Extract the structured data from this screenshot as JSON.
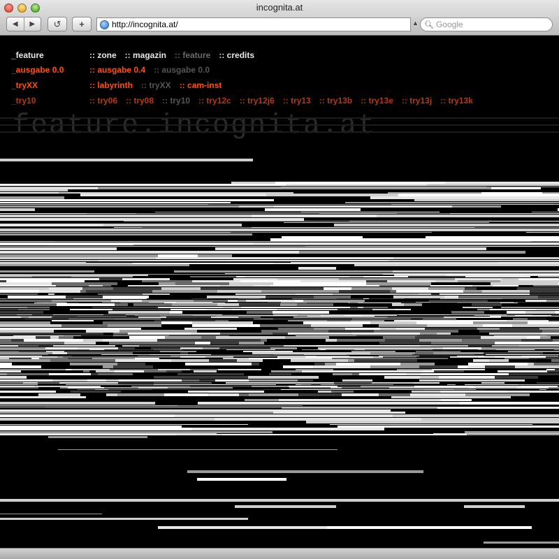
{
  "window": {
    "title": "incognita.at"
  },
  "toolbar": {
    "back_icon": "back-arrow-icon",
    "forward_icon": "forward-arrow-icon",
    "reload_icon": "reload-icon",
    "add_icon": "plus-icon",
    "url": "http://incognita.at/",
    "search_placeholder": "Google"
  },
  "nav": [
    {
      "label": "_feature",
      "label_color": "white",
      "links": [
        {
          "text": ":: zone",
          "color": "white"
        },
        {
          "text": ":: magazin",
          "color": "white"
        },
        {
          "text": ":: feature",
          "color": "gray"
        },
        {
          "text": ":: credits",
          "color": "white"
        }
      ]
    },
    {
      "label": "_ausgabe 0.0",
      "label_color": "orange",
      "links": [
        {
          "text": ":: ausgabe 0.4",
          "color": "orange"
        },
        {
          "text": ":: ausgabe 0.0",
          "color": "grayd"
        }
      ]
    },
    {
      "label": "_tryXX",
      "label_color": "orange",
      "links": [
        {
          "text": ":: labyrinth",
          "color": "orange"
        },
        {
          "text": ":: tryXX",
          "color": "grayd"
        },
        {
          "text": ":: cam-inst",
          "color": "orange"
        }
      ]
    },
    {
      "label": "_try10",
      "label_color": "dim",
      "links": [
        {
          "text": ":: try06",
          "color": "dim"
        },
        {
          "text": ":: try08",
          "color": "dim"
        },
        {
          "text": ":: try10",
          "color": "grayd"
        },
        {
          "text": ":: try12c",
          "color": "dim"
        },
        {
          "text": ":: try12j6",
          "color": "dim"
        },
        {
          "text": ":: try13",
          "color": "dim"
        },
        {
          "text": ":: try13b",
          "color": "dim"
        },
        {
          "text": ":: try13e",
          "color": "dim"
        },
        {
          "text": ":: try13j",
          "color": "dim"
        },
        {
          "text": ":: try13k",
          "color": "dim"
        }
      ]
    }
  ],
  "watermark": "feature.incognita.at",
  "colors": {
    "white": "#e8e8e8",
    "gray": "#6a6a6a",
    "orange": "#ff5010",
    "dim": "#b33a12",
    "grayd": "#555555"
  }
}
